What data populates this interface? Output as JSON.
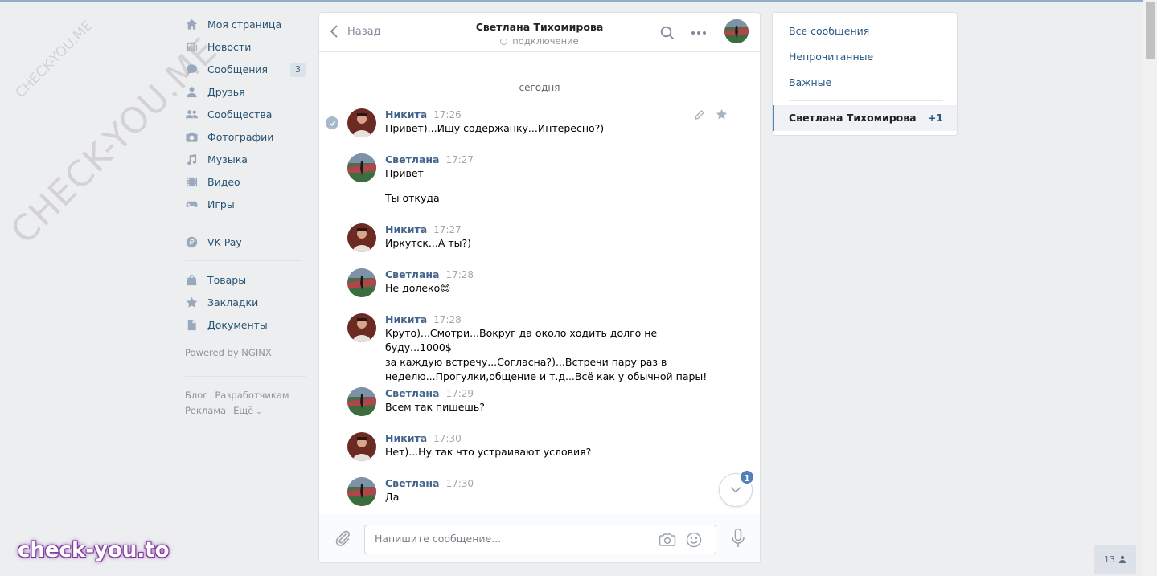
{
  "nav": {
    "items": [
      {
        "label": "Моя страница",
        "icon": "home-icon"
      },
      {
        "label": "Новости",
        "icon": "news-icon"
      },
      {
        "label": "Сообщения",
        "icon": "messages-icon",
        "count": "3"
      },
      {
        "label": "Друзья",
        "icon": "user-icon"
      },
      {
        "label": "Сообщества",
        "icon": "groups-icon"
      },
      {
        "label": "Фотографии",
        "icon": "camera-icon"
      },
      {
        "label": "Музыка",
        "icon": "music-icon"
      },
      {
        "label": "Видео",
        "icon": "video-icon"
      },
      {
        "label": "Игры",
        "icon": "gamepad-icon"
      }
    ],
    "pay": {
      "label": "VK Pay",
      "icon": "ruble-icon"
    },
    "extra": [
      {
        "label": "Товары",
        "icon": "bag-icon"
      },
      {
        "label": "Закладки",
        "icon": "star-icon"
      },
      {
        "label": "Документы",
        "icon": "document-icon"
      }
    ],
    "powered": "Powered by NGINX",
    "footer": {
      "blog": "Блог",
      "dev": "Разработчикам",
      "ads": "Реклама",
      "more": "Ещё"
    }
  },
  "chat": {
    "back_label": "Назад",
    "title": "Светлана Тихомирова",
    "status": "подключение",
    "date_divider": "сегодня",
    "messages": [
      {
        "author": "Никита",
        "time": "17:26",
        "texts": [
          "Привет)...Ищу содержанку...Интересно?)"
        ]
      },
      {
        "author": "Светлана",
        "time": "17:27",
        "texts": [
          "Привет",
          "Ты откуда"
        ]
      },
      {
        "author": "Никита",
        "time": "17:27",
        "texts": [
          "Иркутск...А ты?)"
        ]
      },
      {
        "author": "Светлана",
        "time": "17:28",
        "texts": [
          "Не долеко😊"
        ]
      },
      {
        "author": "Никита",
        "time": "17:28",
        "texts": [
          "Круто)...Смотри...Вокруг да около ходить долго не буду...1000$\nза каждую встречу...Согласна?)...Встречи пару раз в\nнеделю...Прогулки,общение и т.д...Всё как у обычной пары!"
        ]
      },
      {
        "author": "Светлана",
        "time": "17:29",
        "texts": [
          "Всем так пишешь?"
        ]
      },
      {
        "author": "Никита",
        "time": "17:30",
        "texts": [
          "Нет)...Ну так что устраивают условия?"
        ]
      },
      {
        "author": "Светлана",
        "time": "17:30",
        "texts": [
          "Да"
        ]
      }
    ],
    "unread_badge": "1",
    "composer_placeholder": "Напишите сообщение..."
  },
  "filters": {
    "all": "Все сообщения",
    "unread": "Непрочитанные",
    "important": "Важные",
    "active_name": "Светлана Тихомирова",
    "active_count": "+1"
  },
  "online_count": "13",
  "watermarks": {
    "diagonal": "CHECK-YOU.ME",
    "small": "CHECK-YOU.ME",
    "bottom": "check-you.to"
  },
  "colors": {
    "accent": "#5181b8",
    "link": "#2a5885",
    "author": "#42648b",
    "background": "#edeef0"
  }
}
